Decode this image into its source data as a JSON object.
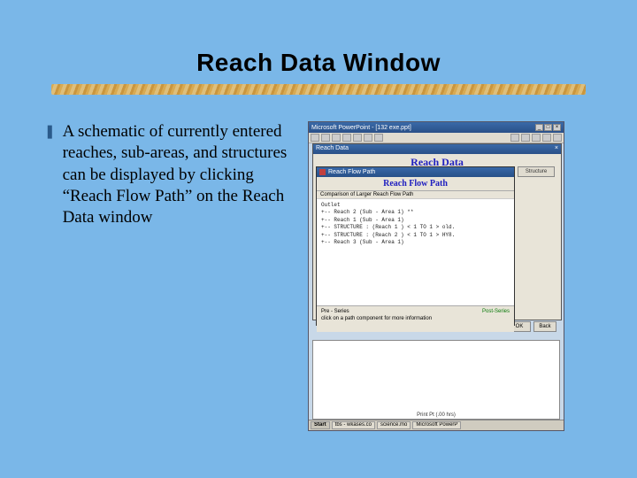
{
  "slide": {
    "title": "Reach Data Window",
    "bullet_glyph": "❚",
    "body": "A schematic of currently entered reaches, sub-areas, and structures can be displayed by clicking “Reach Flow Path” on the Reach Data window"
  },
  "screenshot": {
    "app_title": "Microsoft PowerPoint - [132 exe.ppt]",
    "reach_data": {
      "window_title": "Reach Data",
      "header": "Reach Data"
    },
    "flow_path": {
      "window_title": "Reach Flow Path",
      "header": "Reach Flow Path",
      "subheader": "Comparison of Larger Reach Flow Path",
      "lines": [
        "Outlet",
        "+-- Reach 2 (Sub - Area 1) **",
        "    +-- Reach 1 (Sub - Area 1)",
        "        +-- STRUCTURE : (Reach 1 ) < 1 TO 1 > old.",
        "    +-- STRUCTURE : (Reach 2 ) < 1 TO 1 > HY8.",
        "    +-- Reach 3 (Sub - Area 1)"
      ],
      "footer_left": "Pre - Series",
      "footer_right": "Post-Series",
      "hint": "click on a path component for more information"
    },
    "side": {
      "structure_btn": "Structure"
    },
    "buttons": {
      "ok": "OK",
      "back": "Back",
      "print_label": "Print Pt   (.00 hrs)"
    },
    "taskbar": {
      "start": "Start",
      "items": [
        "tbs - wkases.co",
        "science.mo",
        "Microsoft PowerP"
      ]
    }
  }
}
